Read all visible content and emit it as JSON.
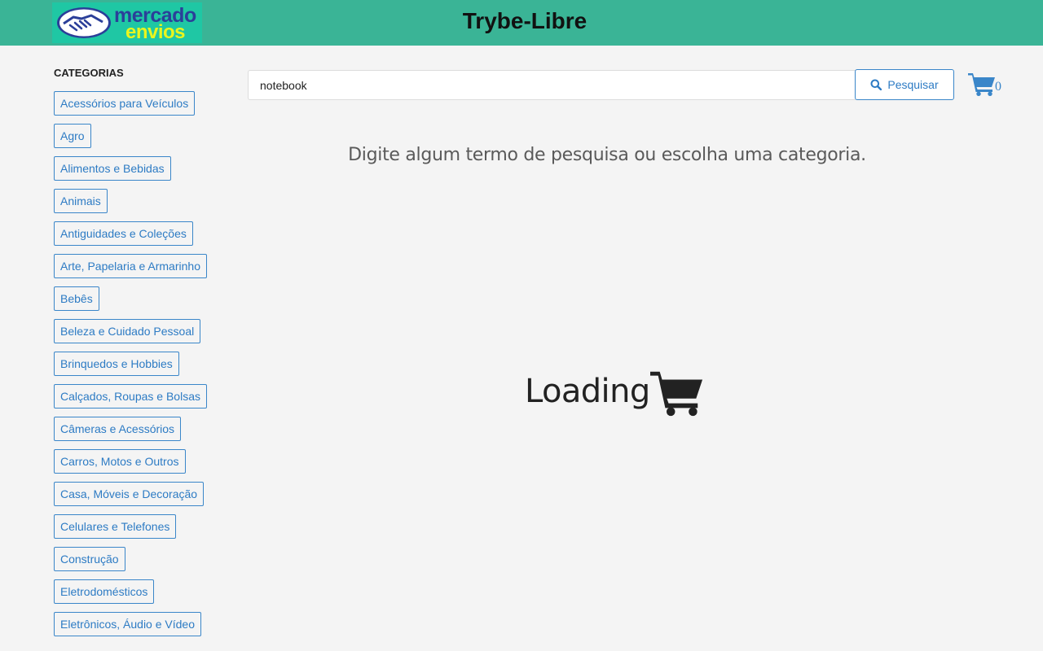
{
  "header": {
    "logo": {
      "line1": "mercado",
      "line2": "envios"
    },
    "title": "Trybe-Libre"
  },
  "sidebar": {
    "heading": "CATEGORIAS",
    "items": [
      "Acessórios para Veículos",
      "Agro",
      "Alimentos e Bebidas",
      "Animais",
      "Antiguidades e Coleções",
      "Arte, Papelaria e Armarinho",
      "Bebês",
      "Beleza e Cuidado Pessoal",
      "Brinquedos e Hobbies",
      "Calçados, Roupas e Bolsas",
      "Câmeras e Acessórios",
      "Carros, Motos e Outros",
      "Casa, Móveis e Decoração",
      "Celulares e Telefones",
      "Construção",
      "Eletrodomésticos",
      "Eletrônicos, Áudio e Vídeo"
    ]
  },
  "search": {
    "value": "notebook",
    "button_label": "Pesquisar",
    "button_icon": "search-icon"
  },
  "cart": {
    "icon": "shopping-cart-icon",
    "count": "0"
  },
  "main": {
    "hint": "Digite algum termo de pesquisa ou escolha uma categoria.",
    "loading_label": "Loading",
    "loading_icon": "shopping-cart-icon"
  },
  "colors": {
    "header_bg": "#3ab496",
    "accent": "#2d7bc4",
    "page_bg": "#f4f4f4"
  }
}
